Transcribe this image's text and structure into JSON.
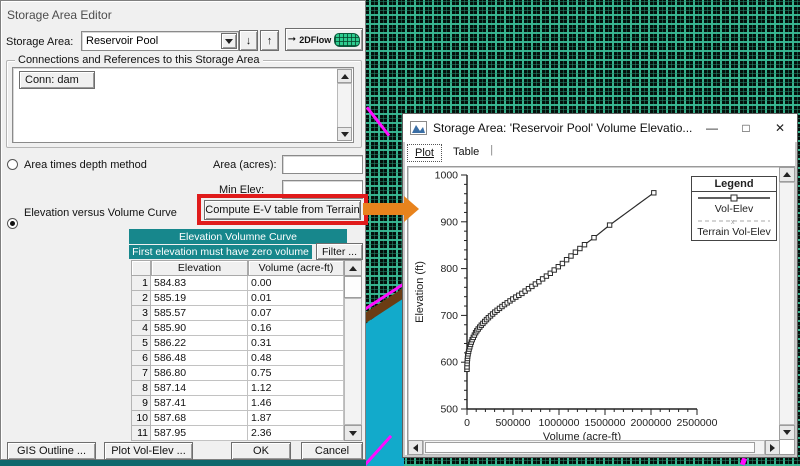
{
  "editor": {
    "title": "Storage Area Editor",
    "storage_area_label": "Storage Area:",
    "storage_area_value": "Reservoir Pool",
    "flow2d_button": "2DFlow",
    "connections_group": "Connections and References to this Storage Area",
    "connection_item": "Conn: dam",
    "radio_area_depth": "Area times depth method",
    "area_label": "Area (acres):",
    "min_elev_label": "Min Elev:",
    "radio_elev_volume": "Elevation versus Volume Curve",
    "compute_button": "Compute E-V table from Terrain",
    "curve_header": "Elevation Volumne Curve",
    "curve_note": "First elevation must have zero volume",
    "filter_button": "Filter ...",
    "table": {
      "headers": [
        "Elevation",
        "Volume (acre-ft)"
      ],
      "rows": [
        [
          "1",
          "584.83",
          "0.00"
        ],
        [
          "2",
          "585.19",
          "0.01"
        ],
        [
          "3",
          "585.57",
          "0.07"
        ],
        [
          "4",
          "585.90",
          "0.16"
        ],
        [
          "5",
          "586.22",
          "0.31"
        ],
        [
          "6",
          "586.48",
          "0.48"
        ],
        [
          "7",
          "586.80",
          "0.75"
        ],
        [
          "8",
          "587.14",
          "1.12"
        ],
        [
          "9",
          "587.41",
          "1.46"
        ],
        [
          "10",
          "587.68",
          "1.87"
        ],
        [
          "11",
          "587.95",
          "2.36"
        ]
      ]
    },
    "buttons": {
      "gis": "GIS Outline ...",
      "plot_vol_elev": "Plot Vol-Elev ...",
      "ok": "OK",
      "cancel": "Cancel"
    }
  },
  "plot_window": {
    "title": "Storage Area: 'Reservoir Pool' Volume Elevatio...",
    "tabs": {
      "plot": "Plot",
      "table": "Table"
    },
    "legend_title": "Legend"
  },
  "chart_data": {
    "type": "line",
    "title": "",
    "xlabel": "Volume  (acre-ft)",
    "ylabel": "Elevation  (ft)",
    "xlim": [
      0,
      2500000
    ],
    "ylim": [
      500,
      1000
    ],
    "x_ticks": [
      0,
      500000,
      1000000,
      1500000,
      2000000,
      2500000
    ],
    "y_ticks": [
      500,
      600,
      700,
      800,
      900,
      1000
    ],
    "x_minor_step": 100000,
    "y_minor_step": 20,
    "grid": false,
    "legend_position": "top-right",
    "series": [
      {
        "name": "Vol-Elev",
        "line": "solid",
        "marker": "square",
        "color": "#2b2b2b",
        "points": [
          [
            0,
            584.8
          ],
          [
            500,
            590
          ],
          [
            1500,
            597
          ],
          [
            3000,
            603
          ],
          [
            5000,
            608
          ],
          [
            8000,
            613
          ],
          [
            12000,
            618
          ],
          [
            17000,
            623
          ],
          [
            23000,
            628
          ],
          [
            30000,
            633
          ],
          [
            38000,
            638
          ],
          [
            47000,
            643
          ],
          [
            57000,
            648
          ],
          [
            68000,
            653
          ],
          [
            80000,
            658
          ],
          [
            93000,
            663
          ],
          [
            107000,
            667
          ],
          [
            122000,
            671
          ],
          [
            138000,
            675
          ],
          [
            155000,
            679
          ],
          [
            173000,
            683
          ],
          [
            192000,
            687
          ],
          [
            212000,
            691
          ],
          [
            233000,
            695
          ],
          [
            255000,
            699
          ],
          [
            278000,
            703
          ],
          [
            302000,
            707
          ],
          [
            327000,
            711
          ],
          [
            353000,
            715
          ],
          [
            380000,
            719
          ],
          [
            408000,
            723
          ],
          [
            437000,
            727
          ],
          [
            467000,
            731
          ],
          [
            498000,
            735
          ],
          [
            530000,
            739
          ],
          [
            563000,
            743
          ],
          [
            597000,
            747
          ],
          [
            632000,
            752
          ],
          [
            668000,
            757
          ],
          [
            705000,
            762
          ],
          [
            743000,
            767
          ],
          [
            782000,
            772
          ],
          [
            822000,
            778
          ],
          [
            863000,
            784
          ],
          [
            905000,
            790
          ],
          [
            948000,
            797
          ],
          [
            992000,
            804
          ],
          [
            1037000,
            811
          ],
          [
            1083000,
            819
          ],
          [
            1130000,
            827
          ],
          [
            1178000,
            835
          ],
          [
            1227000,
            843
          ],
          [
            1277000,
            851
          ],
          [
            1380000,
            866
          ],
          [
            1550000,
            893
          ],
          [
            2030000,
            962
          ]
        ]
      },
      {
        "name": "Terrain Vol-Elev",
        "line": "dashed",
        "marker": "x",
        "color": "#9a9a9a",
        "points": "same-as-first"
      }
    ]
  },
  "colors": {
    "highlight_red": "#e01b1b",
    "arrow_orange": "#e8831d",
    "teal_header": "#17878c",
    "mesh_green": "#39ba94",
    "map_cyan": "#12aacb",
    "map_magenta": "#ff0dff"
  }
}
